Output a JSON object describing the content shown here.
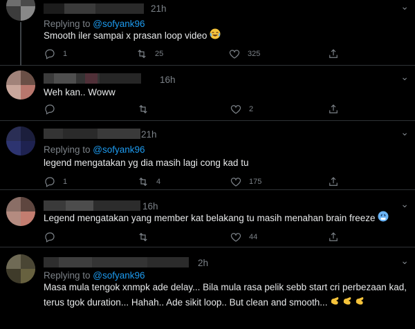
{
  "tweets": [
    {
      "time": "21h",
      "replying_prefix": "Replying to ",
      "replying_handle": "@sofyank96",
      "lines": [
        "Smooth iler sampai x prasan loop video"
      ],
      "reply_count": "1",
      "retweet_count": "25",
      "like_count": "325"
    },
    {
      "time": "16h",
      "lines": [
        "Weh kan.. Woww"
      ],
      "reply_count": "",
      "retweet_count": "",
      "like_count": "2"
    },
    {
      "time": "21h",
      "replying_prefix": "Replying to ",
      "replying_handle": "@sofyank96",
      "lines": [
        "legend mengatakan yg dia masih lagi cong kad tu"
      ],
      "reply_count": "1",
      "retweet_count": "4",
      "like_count": "175"
    },
    {
      "time": "16h",
      "lines": [
        "Legend mengatakan yang member kat belakang tu masih menahan brain freeze"
      ],
      "reply_count": "",
      "retweet_count": "",
      "like_count": "44"
    },
    {
      "time": "2h",
      "replying_prefix": "Replying to ",
      "replying_handle": "@sofyank96",
      "lines": [
        "Masa mula tengok xnmpk ade delay... Bila mula rasa pelik sebb start cri perbezaan kad,",
        "terus tgok duration... Hahah.. Ade sikit loop.. But clean and smooth..."
      ],
      "reply_count": "",
      "retweet_count": "",
      "like_count": ""
    }
  ],
  "icons": {
    "reply": "reply-icon",
    "retweet": "retweet-icon",
    "like": "like-icon",
    "share": "share-icon",
    "more": "more-icon"
  },
  "colors": {
    "background": "#000000",
    "text": "#e7e9ea",
    "muted": "#7c8288",
    "link": "#1d9bf0",
    "divider": "#2f3336"
  }
}
